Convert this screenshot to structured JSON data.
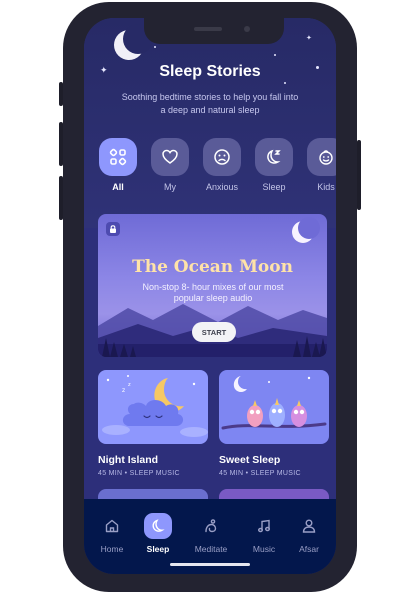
{
  "header": {
    "title": "Sleep Stories",
    "subtitle": "Soothing bedtime stories to help you fall into a deep and natural sleep"
  },
  "categories": [
    {
      "label": "All",
      "icon": "grid-icon",
      "active": true
    },
    {
      "label": "My",
      "icon": "heart-icon",
      "active": false
    },
    {
      "label": "Anxious",
      "icon": "sad-face-icon",
      "active": false
    },
    {
      "label": "Sleep",
      "icon": "moon-icon",
      "active": false
    },
    {
      "label": "Kids",
      "icon": "kid-face-icon",
      "active": false
    }
  ],
  "hero": {
    "title": "The Ocean Moon",
    "subtitle": "Non-stop 8- hour mixes of our most popular sleep audio",
    "button": "START"
  },
  "stories": [
    {
      "title": "Night Island",
      "meta": "45 MIN • SLEEP MUSIC"
    },
    {
      "title": "Sweet Sleep",
      "meta": "45 MIN • SLEEP MUSIC"
    }
  ],
  "tabs": [
    {
      "label": "Home",
      "icon": "home-icon",
      "active": false
    },
    {
      "label": "Sleep",
      "icon": "moon-icon",
      "active": true
    },
    {
      "label": "Meditate",
      "icon": "meditate-icon",
      "active": false
    },
    {
      "label": "Music",
      "icon": "music-icon",
      "active": false
    },
    {
      "label": "Afsar",
      "icon": "user-icon",
      "active": false
    }
  ],
  "colors": {
    "background": "#2d2f7a",
    "accent": "#8e97fd",
    "tabbar": "#03174c",
    "hero_title": "#ffe3a8"
  }
}
